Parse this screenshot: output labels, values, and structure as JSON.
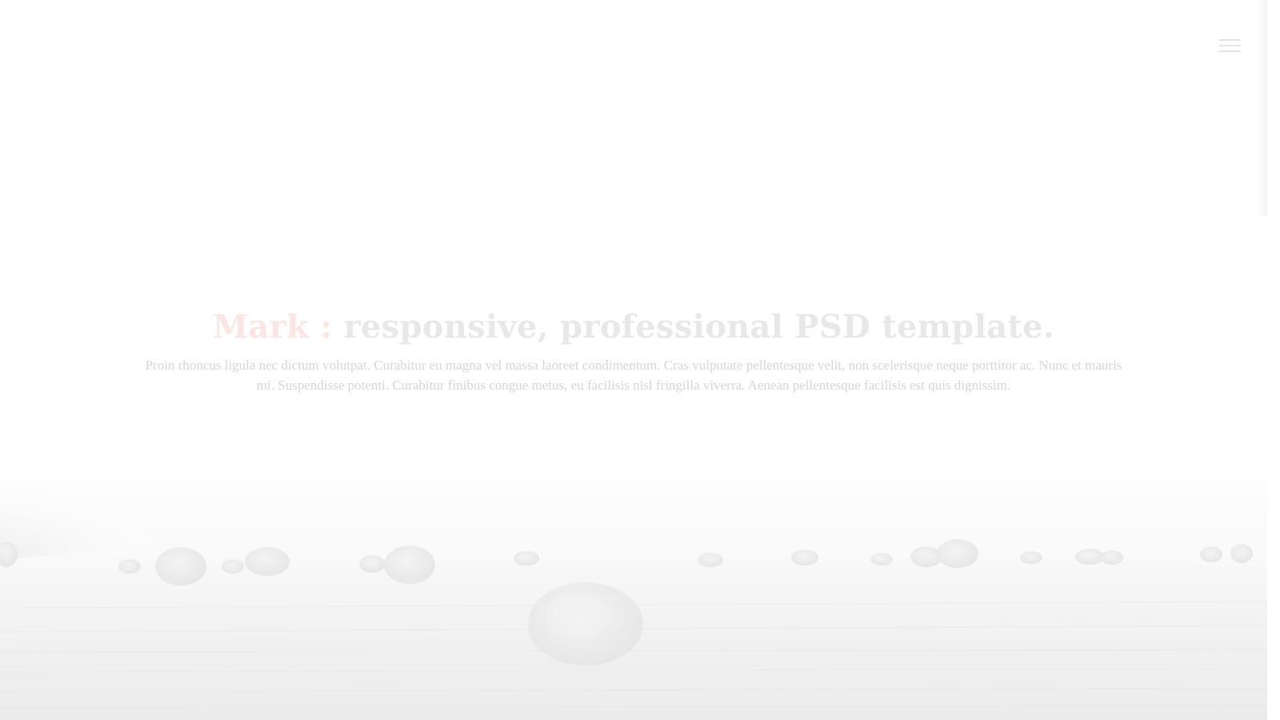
{
  "header": {
    "menu_icon": "hamburger-icon"
  },
  "hero": {
    "title_brand": "Mark :",
    "title_rest": "responsive, professional PSD template.",
    "description": "Proin rhoncus ligula nec dictum volutpat. Curabitur eu magna vel massa laoreet condimentum. Cras vulputate pellentesque velit, non scelerisque neque porttitor ac. Nunc et mauris mi. Suspendisse potenti. Curabitur finibus congue metus, eu facilisis nisl fringilla viverra. Aenean pellentesque facilisis est quis dignissim.",
    "background_image": "hay-bales-field-photo"
  },
  "colors": {
    "brand_accent": "#fbe6e3",
    "title": "#e8e8e8",
    "body_text": "#d6d6d6",
    "background": "#ffffff"
  }
}
